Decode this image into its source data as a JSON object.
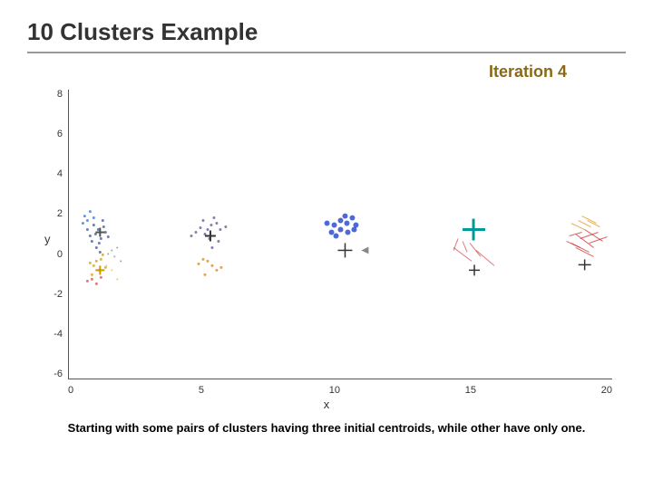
{
  "slide": {
    "title": "10 Clusters Example",
    "iteration_label": "Iteration 4",
    "caption": "Starting with some pairs of clusters having three initial centroids, while other have only one.",
    "y_axis_label": "y",
    "x_axis_label": "x",
    "y_ticks": [
      "8",
      "6",
      "4",
      "2",
      "0",
      "-2",
      "-4",
      "-6"
    ],
    "x_ticks": [
      "0",
      "5",
      "10",
      "15",
      "20"
    ]
  }
}
